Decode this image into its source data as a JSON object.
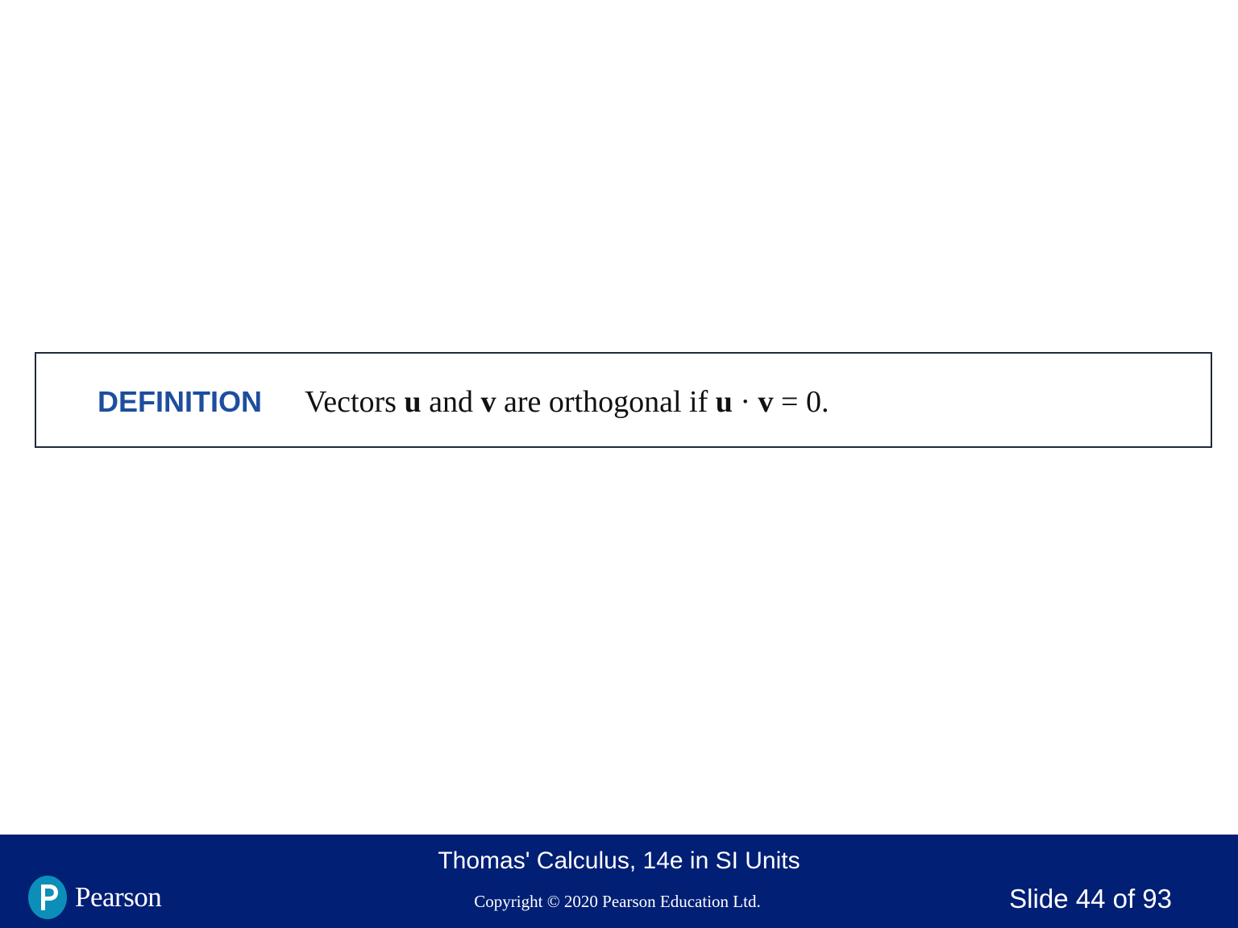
{
  "definition": {
    "label": "DEFINITION",
    "text_parts": [
      "Vectors ",
      "u",
      " and ",
      "v",
      " are orthogonal if ",
      "u",
      " · ",
      "v",
      " = 0."
    ]
  },
  "footer": {
    "book_title": "Thomas' Calculus, 14e in SI Units",
    "copyright": "Copyright © 2020 Pearson Education Ltd.",
    "slide_number": "Slide 44 of 93",
    "logo_text": "Pearson"
  },
  "colors": {
    "footer_bg": "#001f75",
    "definition_label": "#1d4e9e",
    "logo_circle": "#0b8fb8"
  },
  "icons": {
    "logo": "pearson-logo-icon"
  }
}
